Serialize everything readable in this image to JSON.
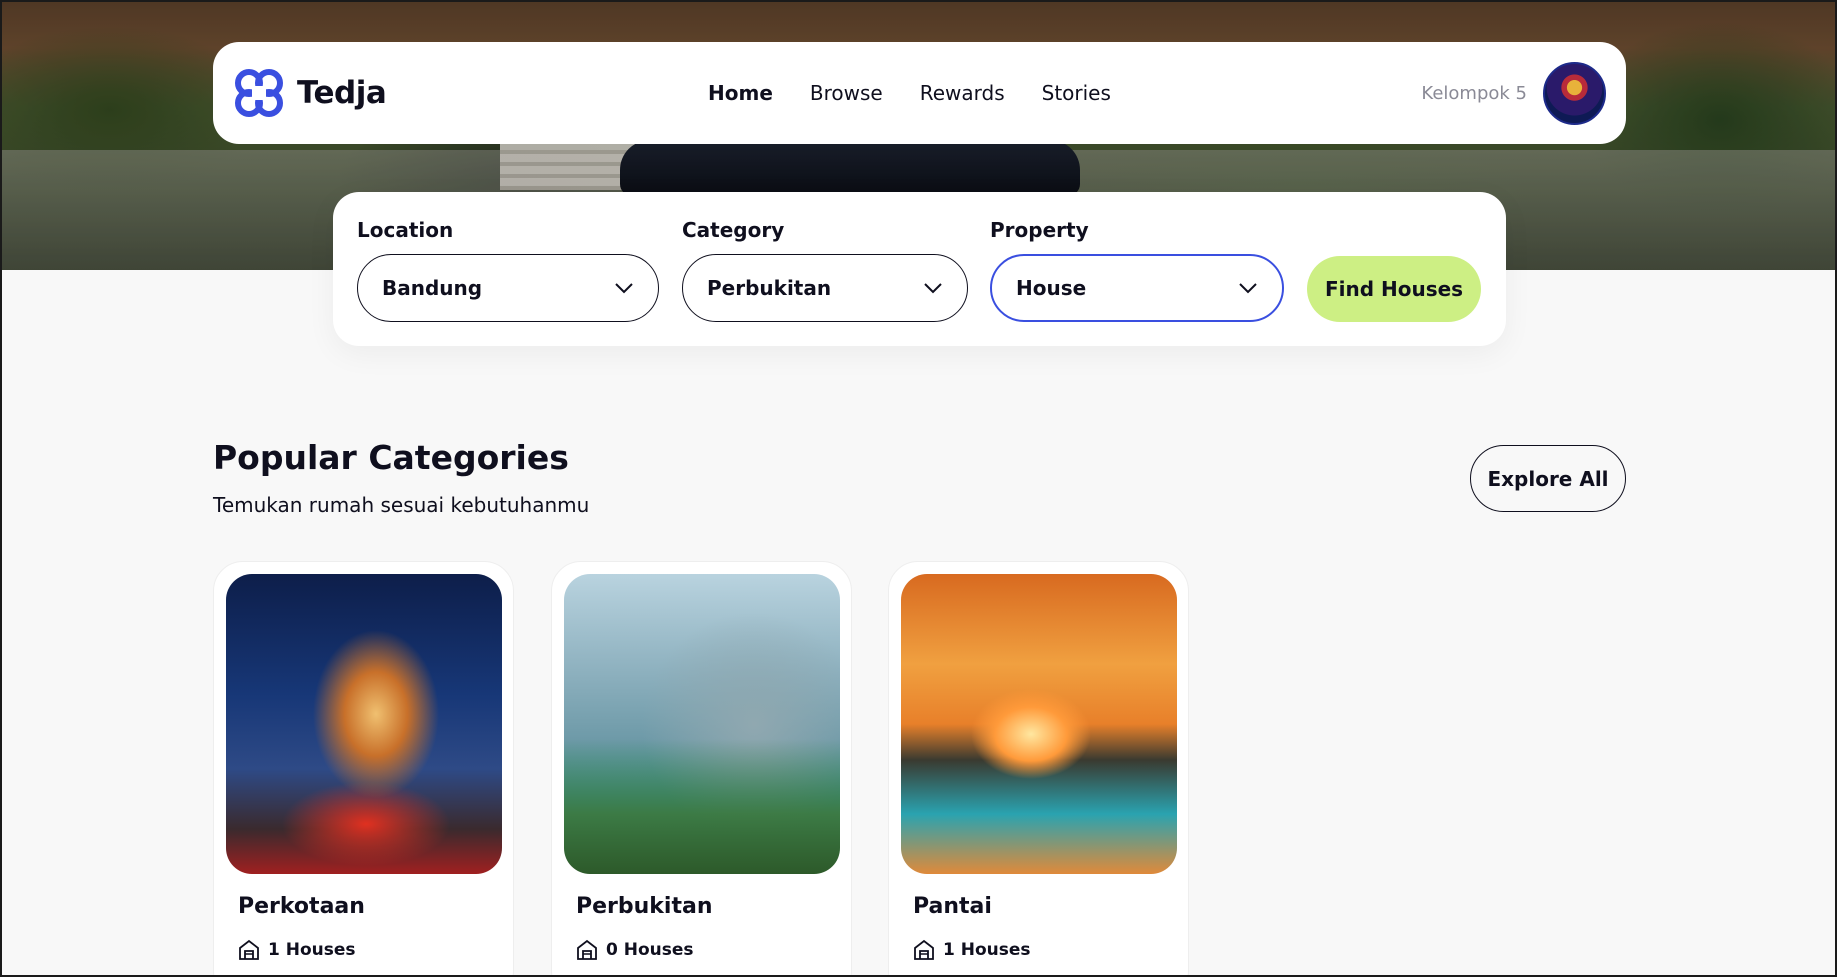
{
  "brand": {
    "name": "Tedja",
    "logo_icon": "clover-logo-icon",
    "logo_color": "#3a4fe0"
  },
  "nav": {
    "links": [
      {
        "label": "Home",
        "active": true
      },
      {
        "label": "Browse",
        "active": false
      },
      {
        "label": "Rewards",
        "active": false
      },
      {
        "label": "Stories",
        "active": false
      }
    ],
    "user_name": "Kelompok 5"
  },
  "search": {
    "location": {
      "label": "Location",
      "value": "Bandung"
    },
    "category": {
      "label": "Category",
      "value": "Perbukitan"
    },
    "property": {
      "label": "Property",
      "value": "House"
    },
    "submit_label": "Find Houses",
    "submit_color": "#cdef84",
    "focus_color": "#3a4fe0"
  },
  "section": {
    "title": "Popular Categories",
    "subtitle": "Temukan rumah sesuai kebutuhanmu",
    "explore_label": "Explore All"
  },
  "categories": [
    {
      "name": "Perkotaan",
      "count": "1 Houses",
      "icon": "house-icon"
    },
    {
      "name": "Perbukitan",
      "count": "0 Houses",
      "icon": "house-icon"
    },
    {
      "name": "Pantai",
      "count": "1 Houses",
      "icon": "house-icon"
    }
  ]
}
